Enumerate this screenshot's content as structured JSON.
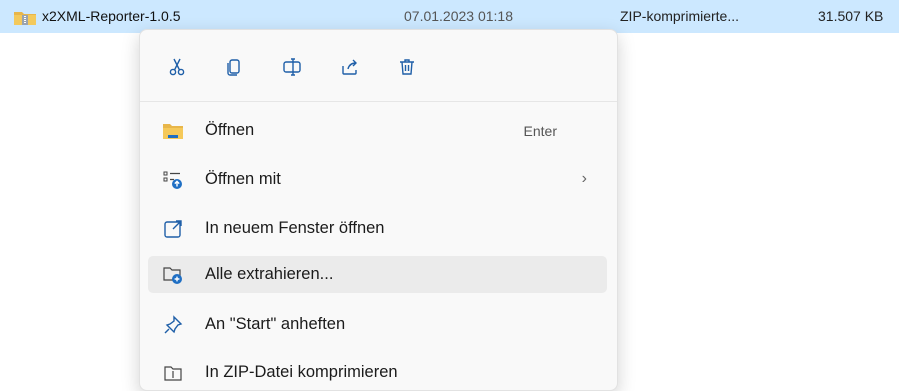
{
  "file": {
    "name": "x2XML-Reporter-1.0.5",
    "date": "07.01.2023 01:18",
    "type": "ZIP-komprimierte...",
    "size": "31.507 KB"
  },
  "quick_actions": [
    {
      "icon": "cut-icon"
    },
    {
      "icon": "copy-icon"
    },
    {
      "icon": "rename-icon"
    },
    {
      "icon": "share-icon"
    },
    {
      "icon": "delete-icon"
    }
  ],
  "menu": {
    "items": [
      {
        "label": "Öffnen",
        "accel": "Enter",
        "icon": "folder-open-icon"
      },
      {
        "label": "Öffnen mit",
        "icon": "open-with-icon",
        "submenu": true
      },
      {
        "label": "In neuem Fenster öffnen",
        "icon": "new-window-icon"
      },
      {
        "label": "Alle extrahieren...",
        "icon": "extract-icon",
        "hover": true
      },
      {
        "label": "An \"Start\" anheften",
        "icon": "pin-icon"
      },
      {
        "label": "In ZIP-Datei komprimieren",
        "icon": "zip-compress-icon"
      }
    ]
  },
  "colors": {
    "selection": "#cce8ff",
    "accent": "#0067c0",
    "menu_bg": "#f9f9f9",
    "hover_bg": "#ebebeb"
  }
}
